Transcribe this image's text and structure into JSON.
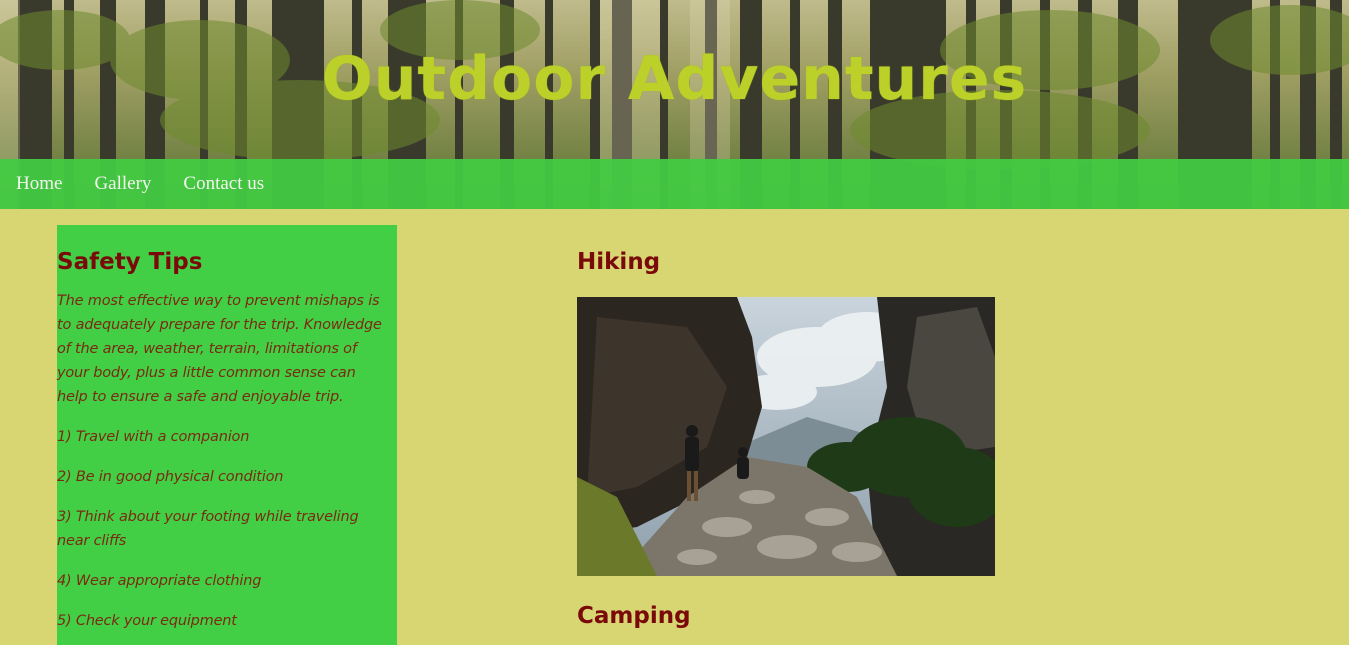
{
  "header": {
    "title": "Outdoor Adventures"
  },
  "nav": {
    "items": [
      "Home",
      "Gallery",
      "Contact us"
    ]
  },
  "sidebar": {
    "heading": "Safety Tips",
    "intro": "The most effective way to prevent mishaps is to adequately prepare for the trip. Knowledge of the area, weather, terrain, limitations of your body, plus a little common sense can help to ensure a safe and enjoyable trip.",
    "tips": [
      "1) Travel with a companion",
      "2) Be in good physical condition",
      "3) Think about your footing while traveling near cliffs",
      "4) Wear appropriate clothing",
      "5) Check your equipment"
    ]
  },
  "main": {
    "sections": [
      {
        "title": "Hiking"
      },
      {
        "title": "Camping"
      }
    ]
  },
  "colors": {
    "page_background": "#d8d673",
    "nav_background": "#43cc43",
    "sidebar_background": "#43cf45",
    "heading_color": "#7a0a0a",
    "title_color": "#bcd02a"
  },
  "images": {
    "banner": "forest-banner",
    "hiking_photo": "mountain-trail-photo"
  }
}
